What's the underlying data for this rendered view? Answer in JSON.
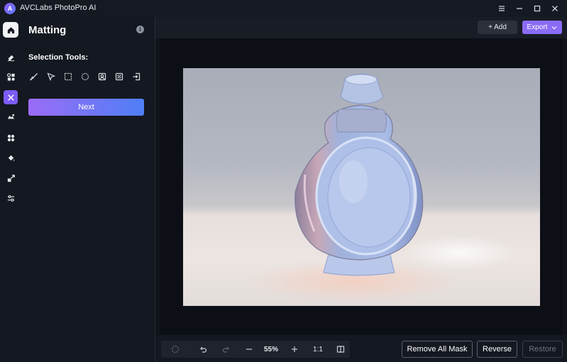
{
  "app": {
    "title": "AVCLabs PhotoPro AI",
    "logo_letter": "A"
  },
  "window_controls": [
    "menu-icon",
    "minimize-icon",
    "maximize-icon",
    "close-icon"
  ],
  "rail": {
    "items": [
      {
        "name": "home-icon"
      },
      {
        "name": "eraser-icon"
      },
      {
        "name": "object-tools-icon"
      },
      {
        "name": "matting-icon",
        "active": true
      },
      {
        "name": "enhance-icon"
      },
      {
        "name": "colorize-icon"
      },
      {
        "name": "fill-icon"
      },
      {
        "name": "upscale-icon"
      },
      {
        "name": "adjust-icon"
      }
    ]
  },
  "panel": {
    "title": "Matting",
    "section_label": "Selection Tools:",
    "tools": [
      "brush-icon",
      "pointer-icon",
      "rectangle-select-icon",
      "ellipse-select-icon",
      "portrait-select-icon",
      "auto-select-icon",
      "import-icon"
    ],
    "next_label": "Next"
  },
  "toolbar": {
    "add_label": "+ Add",
    "export_label": "Export"
  },
  "bottom": {
    "zoom": "55%",
    "ratio": "1:1",
    "remove_all_mask": "Remove All Mask",
    "reverse": "Reverse",
    "restore": "Restore"
  },
  "colors": {
    "accent": "#8b6cf6",
    "active_rail": "#7c5cf5",
    "next_gradient_start": "#9b6cf7",
    "next_gradient_end": "#4f7ff6"
  }
}
